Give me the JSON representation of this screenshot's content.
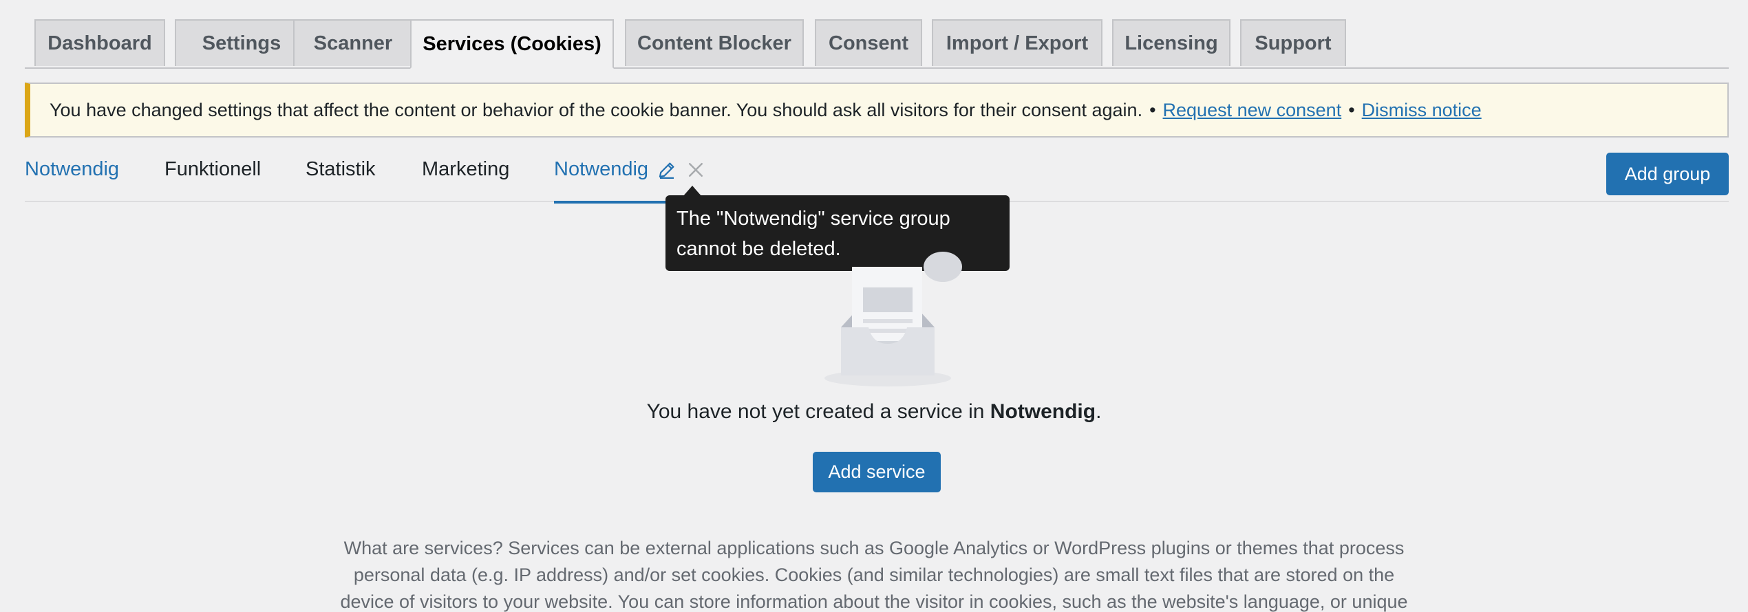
{
  "nav_tabs": [
    {
      "label": "Dashboard",
      "active": false
    },
    {
      "label": "Settings",
      "active": false
    },
    {
      "label": "Scanner",
      "active": false
    },
    {
      "label": "Services (Cookies)",
      "active": true
    },
    {
      "label": "Content Blocker",
      "active": false
    },
    {
      "label": "Consent",
      "active": false
    },
    {
      "label": "Import / Export",
      "active": false
    },
    {
      "label": "Licensing",
      "active": false
    },
    {
      "label": "Support",
      "active": false
    }
  ],
  "notice": {
    "text": "You have changed settings that affect the content or behavior of the cookie banner. You should ask all visitors for their consent again.",
    "separator": "•",
    "request_link": "Request new consent",
    "dismiss_link": "Dismiss notice"
  },
  "group_tabs": {
    "items": [
      {
        "label": "Notwendig"
      },
      {
        "label": "Funktionell"
      },
      {
        "label": "Statistik"
      },
      {
        "label": "Marketing"
      }
    ],
    "active_label": "Notwendig",
    "add_group_label": "Add group"
  },
  "tooltip": {
    "line1": "The \"Notwendig\" service group",
    "line2": "cannot be deleted."
  },
  "empty_state": {
    "text_prefix": "You have not yet created a service in",
    "group_name": "Notwendig",
    "text_suffix": ".",
    "add_service_label": "Add service"
  },
  "description": {
    "lines": [
      "What are services? Services can be external applications such as Google Analytics or WordPress plugins or themes that process",
      "personal data (e.g. IP address) and/or set cookies. Cookies (and similar technologies) are small text files that are stored on the",
      "device of visitors to your website. You can store information about the visitor in cookies, such as the website's language, or unique"
    ]
  },
  "colors": {
    "accent": "#2271b1",
    "notice_border": "#dba617",
    "notice_bg": "#fcf9e8",
    "tooltip_bg": "#1e1e1e",
    "page_bg": "#f0f0f1"
  }
}
